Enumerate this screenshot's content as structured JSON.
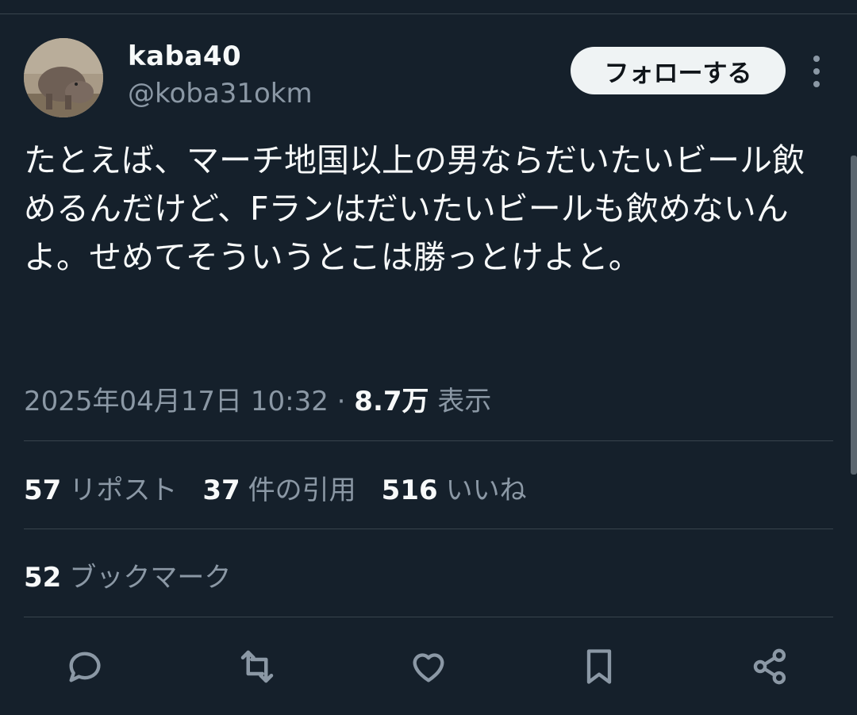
{
  "author": {
    "display_name": "kaba40",
    "handle": "@koba31okm"
  },
  "follow_button": "フォローする",
  "tweet": {
    "text": "たとえば、マーチ地国以上の男ならだいたいビール飲めるんだけど、Fランはだいたいビールも飲めないんよ。せめてそういうとこは勝っとけよと。"
  },
  "meta": {
    "timestamp": "2025年04月17日 10:32",
    "separator": " · ",
    "views_count": "8.7万",
    "views_label": "表示"
  },
  "stats": {
    "reposts": {
      "count": "57",
      "label": "リポスト"
    },
    "quotes": {
      "count": "37",
      "label": "件の引用"
    },
    "likes": {
      "count": "516",
      "label": "いいね"
    },
    "bookmarks": {
      "count": "52",
      "label": "ブックマーク"
    }
  },
  "icons": [
    "reply-icon",
    "repost-icon",
    "like-icon",
    "bookmark-icon",
    "share-icon",
    "more-icon"
  ],
  "colors": {
    "background": "#15202b",
    "primary_text": "#f7f9f9",
    "secondary_text": "#8b98a5",
    "divider": "#38444d",
    "follow_button_bg": "#eff3f4"
  }
}
